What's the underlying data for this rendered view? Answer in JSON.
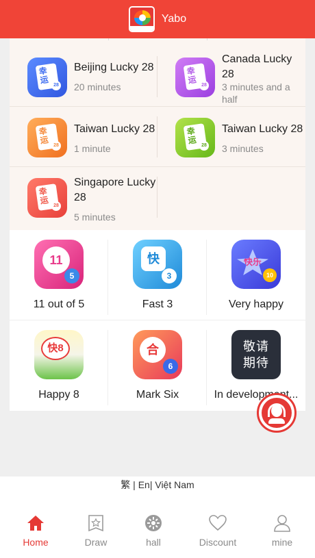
{
  "header": {
    "title": "Yabo",
    "logo_icon": "yabo-logo"
  },
  "lucky_games": [
    {
      "name": "Beijing Lucky 28",
      "time": "20 minutes",
      "icon": "lucky28-icon",
      "icon_text": "幸运",
      "ball": "28",
      "color": "#3f6ef0"
    },
    {
      "name": "Canada Lucky 28",
      "time": "3 minutes and a half",
      "icon": "lucky28-icon",
      "icon_text": "幸运",
      "ball": "28",
      "color": "#b25be8"
    },
    {
      "name": "Taiwan Lucky 28",
      "time": "1 minute",
      "icon": "lucky28-icon",
      "icon_text": "幸运",
      "ball": "28",
      "color": "#f5893a"
    },
    {
      "name": "Taiwan Lucky 28",
      "time": "3 minutes",
      "icon": "lucky28-icon",
      "icon_text": "幸运",
      "ball": "28",
      "color": "#8fcf2a"
    },
    {
      "name": "Singapore Lucky 28",
      "time": "5 minutes",
      "icon": "lucky28-icon",
      "icon_text": "幸运",
      "ball": "28",
      "color": "#f05a4a"
    }
  ],
  "games": [
    {
      "label": "11 out of 5",
      "icon": "11x5-icon",
      "icon_text": "11",
      "ball": "5",
      "color": "#e83a8a"
    },
    {
      "label": "Fast 3",
      "icon": "fast3-icon",
      "icon_text": "快",
      "ball": "3",
      "color": "#3aa8e8"
    },
    {
      "label": "Very happy",
      "icon": "very-happy-icon",
      "icon_text": "快乐",
      "ball": "10",
      "color": "#4a5ae8"
    },
    {
      "label": "Happy 8",
      "icon": "happy8-icon",
      "icon_text": "快8",
      "ball": "",
      "color": "#6cc34a"
    },
    {
      "label": "Mark Six",
      "icon": "mark-six-icon",
      "icon_text": "合",
      "ball": "6",
      "color": "#f05a6a"
    },
    {
      "label": "In development...",
      "icon": "coming-soon-icon",
      "icon_text": "敬请期待",
      "ball": "",
      "color": "#2a2f3a"
    }
  ],
  "languages": "繁 | En| Việt Nam",
  "tabs": [
    {
      "label": "Home",
      "icon": "home-icon",
      "active": true
    },
    {
      "label": "Draw",
      "icon": "draw-icon",
      "active": false
    },
    {
      "label": "hall",
      "icon": "hall-icon",
      "active": false
    },
    {
      "label": "Discount",
      "icon": "heart-icon",
      "active": false
    },
    {
      "label": "mine",
      "icon": "user-icon",
      "active": false
    }
  ],
  "colors": {
    "brand": "#f04437",
    "active_tab": "#e53935"
  }
}
